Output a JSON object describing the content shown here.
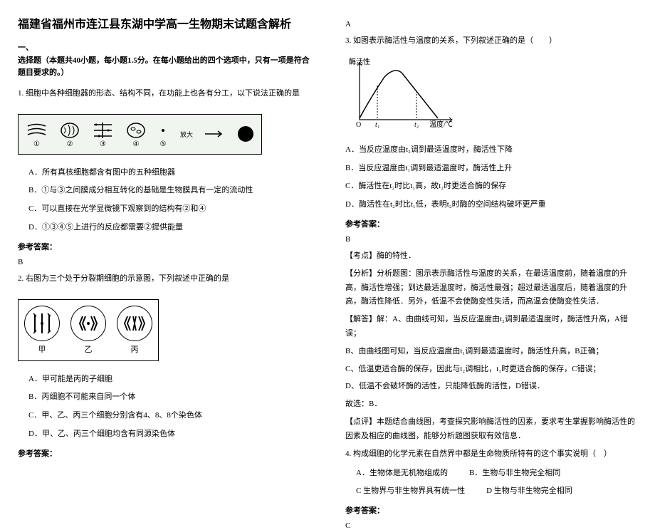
{
  "title": "福建省福州市连江县东湖中学高一生物期末试题含解析",
  "section1": {
    "head": "一、",
    "desc": "选择题（本题共40小题，每小题1.5分。在每小题给出的四个选项中，只有一项是符合题目要求的。）"
  },
  "q1": {
    "text": "1. 细胞中各种细胞器的形态、结构不同，在功能上也各有分工，以下说法正确的是",
    "labels": [
      "①",
      "②",
      "③",
      "④",
      "⑤"
    ],
    "arrow": "放大",
    "optA": "A．所有真核细胞都含有图中的五种细胞器",
    "optB": "B．①与③之间膜成分相互转化的基础是生物膜具有一定的流动性",
    "optC": "C．可以直接在光学显微镜下观察到的结构有②和④",
    "optD": "D．①③④⑤上进行的反应都需要②提供能量",
    "answerLabel": "参考答案：",
    "answer": "B"
  },
  "q2": {
    "text": "2. 右图为三个处于分裂期细胞的示意图，下列叙述中正确的是",
    "labels": [
      "甲",
      "乙",
      "丙"
    ],
    "optA": "A．甲可能是丙的子细胞",
    "optB": "B．丙细胞不可能来自同一个体",
    "optC": "C．甲、乙、丙三个细胞分别含有4、8、8个染色体",
    "optD": "D．甲、乙、丙三个细胞均含有同源染色体",
    "answerLabel": "参考答案：",
    "answer": "A"
  },
  "q3": {
    "text": "3. 如图表示酶活性与温度的关系，下列叙述正确的是（　　）",
    "ylabel": "酶活性",
    "xlabel": "温度/℃",
    "xticks": [
      "O",
      "t₁",
      "t₂"
    ],
    "optA": "A．当反应温度由t₂调到最适温度时，酶活性下降",
    "optB": "B．当反应温度由t₁调到最适温度时，酶活性上升",
    "optC": "C．酶活性在t₂时比t₁高，故t₂时更适合酶的保存",
    "optD": "D．酶活性在t₂时比t₁低，表明t₂时酶的空间结构破坏更严重",
    "answerLabel": "参考答案：",
    "answer": "B",
    "point": "【考点】酶的特性．",
    "analysis": "【分析】分析题图：图示表示酶活性与温度的关系，在最适温度前，随着温度的升高，酶活性增强；到达最适温度时，酶活性最强；超过最适温度后，随着温度的升高，酶活性降低．另外，低温不会使酶变性失活，而高温会使酶变性失活．",
    "solveLabel": "【解答】解：",
    "solveA": "A、由曲线可知，当反应温度由t₂调到最适温度时，酶活性升高，A错误；",
    "solveB": "B、由曲线图可知，当反应温度由t₁调到最适温度时，酶活性升高，B正确；",
    "solveC": "C、低温更适合酶的保存，因此与t₂调相比，t₁时更适合酶的保存，C错误；",
    "solveD": "D、低温不会破坏酶的活性，只能降低酶的活性，D错误．",
    "choose": "故选：B．",
    "comment": "【点评】本题结合曲线图，考查探究影响酶活性的因素，要求考生掌握影响酶活性的因素及相应的曲线图，能够分析题图获取有效信息．"
  },
  "q4": {
    "text": "4. 构成细胞的化学元素在自然界中都是生命物质所特有的这个事实说明（　）",
    "optA": "A．生物体是无机物组成的",
    "optB": "B．生物与非生物完全相同",
    "optC": "C 生物界与非生物界具有统一性",
    "optD": "D 生物与非生物完全相同",
    "answerLabel": "参考答案：",
    "answer": "C"
  }
}
